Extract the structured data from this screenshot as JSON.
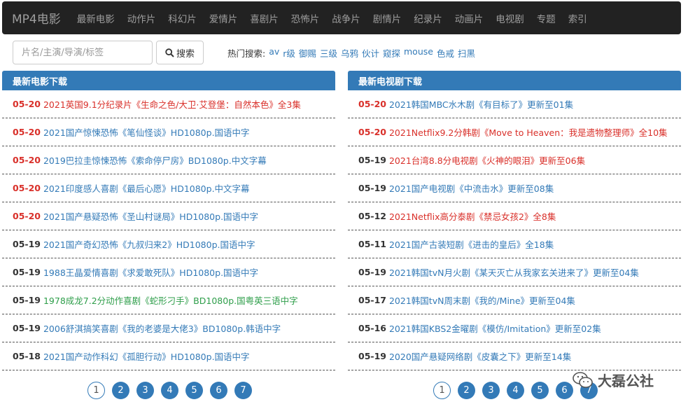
{
  "nav": {
    "brand": "MP4电影",
    "items": [
      "最新电影",
      "动作片",
      "科幻片",
      "爱情片",
      "喜剧片",
      "恐怖片",
      "战争片",
      "剧情片",
      "纪录片",
      "动画片",
      "电视剧",
      "专题",
      "索引"
    ]
  },
  "search": {
    "placeholder": "片名/主演/导演/标签",
    "button_label": "搜索",
    "hot_label": "热门搜索:",
    "hot_items": [
      "av",
      "r级",
      "御赐",
      "三级",
      "乌鸦",
      "伙计",
      "窥探",
      "mouse",
      "色戒",
      "扫黑"
    ]
  },
  "colors": {
    "accent": "#337ab7",
    "highlight": "#d9302a",
    "green": "#2e9e4a",
    "navbar": "#222222"
  },
  "movies": {
    "header": "最新电影下载",
    "rows": [
      {
        "date": "05-20",
        "title": "2021英国9.1分纪录片《生命之色/大卫·艾登堡：自然本色》全3集",
        "style": "red"
      },
      {
        "date": "05-20",
        "title": "2021国产惊悚恐怖《笔仙怪谈》HD1080p.国语中字",
        "style": "redDate"
      },
      {
        "date": "05-20",
        "title": "2019巴拉圭惊悚恐怖《索命停尸房》BD1080p.中文字幕",
        "style": "redDate"
      },
      {
        "date": "05-20",
        "title": "2021印度感人喜剧《最后心愿》HD1080p.中文字幕",
        "style": "redDate"
      },
      {
        "date": "05-20",
        "title": "2021国产悬疑恐怖《圣山村谜局》HD1080p.国语中字",
        "style": "redDate"
      },
      {
        "date": "05-19",
        "title": "2021国产奇幻恐怖《九叔归来2》HD1080p.国语中字",
        "style": "normal"
      },
      {
        "date": "05-19",
        "title": "1988王晶爱情喜剧《求爱敢死队》HD1080p.国语中字",
        "style": "normal"
      },
      {
        "date": "05-19",
        "title": "1978成龙7.2分动作喜剧《蛇形刁手》BD1080p.国粤英三语中字",
        "style": "green"
      },
      {
        "date": "05-19",
        "title": "2006舒淇搞笑喜剧《我的老婆是大佬3》BD1080p.韩语中字",
        "style": "normal"
      },
      {
        "date": "05-18",
        "title": "2021国产动作科幻《孤胆行动》HD1080p.国语中字",
        "style": "normal"
      }
    ]
  },
  "tv": {
    "header": "最新电视剧下载",
    "rows": [
      {
        "date": "05-20",
        "title": "2021韩国MBC水木剧《有目标了》更新至01集",
        "style": "redDate"
      },
      {
        "date": "05-20",
        "title": "2021Netflix9.2分韩剧《Move to Heaven：我是遗物整理师》全10集",
        "style": "red"
      },
      {
        "date": "05-19",
        "title": "2021台湾8.8分电视剧《火神的眼泪》更新至06集",
        "style": "redTitle"
      },
      {
        "date": "05-19",
        "title": "2021国产电视剧《中流击水》更新至08集",
        "style": "normal"
      },
      {
        "date": "05-12",
        "title": "2021Netflix高分泰剧《禁忌女孩2》全8集",
        "style": "redTitle"
      },
      {
        "date": "05-11",
        "title": "2021国产古装短剧《进击的皇后》全18集",
        "style": "normal"
      },
      {
        "date": "05-19",
        "title": "2021韩国tvN月火剧《某天灭亡从我家玄关进来了》更新至04集",
        "style": "normal"
      },
      {
        "date": "05-17",
        "title": "2021韩国tvN周末剧《我的/Mine》更新至04集",
        "style": "normal"
      },
      {
        "date": "05-16",
        "title": "2021韩国KBS2金曜剧《模仿/Imitation》更新至02集",
        "style": "normal"
      },
      {
        "date": "05-19",
        "title": "2020国产悬疑网络剧《皮囊之下》更新至14集",
        "style": "normal"
      }
    ]
  },
  "pagination": {
    "pages": [
      "1",
      "2",
      "3",
      "4",
      "5",
      "6",
      "7"
    ],
    "current": "1"
  },
  "watermark": {
    "text": "大磊公社"
  }
}
